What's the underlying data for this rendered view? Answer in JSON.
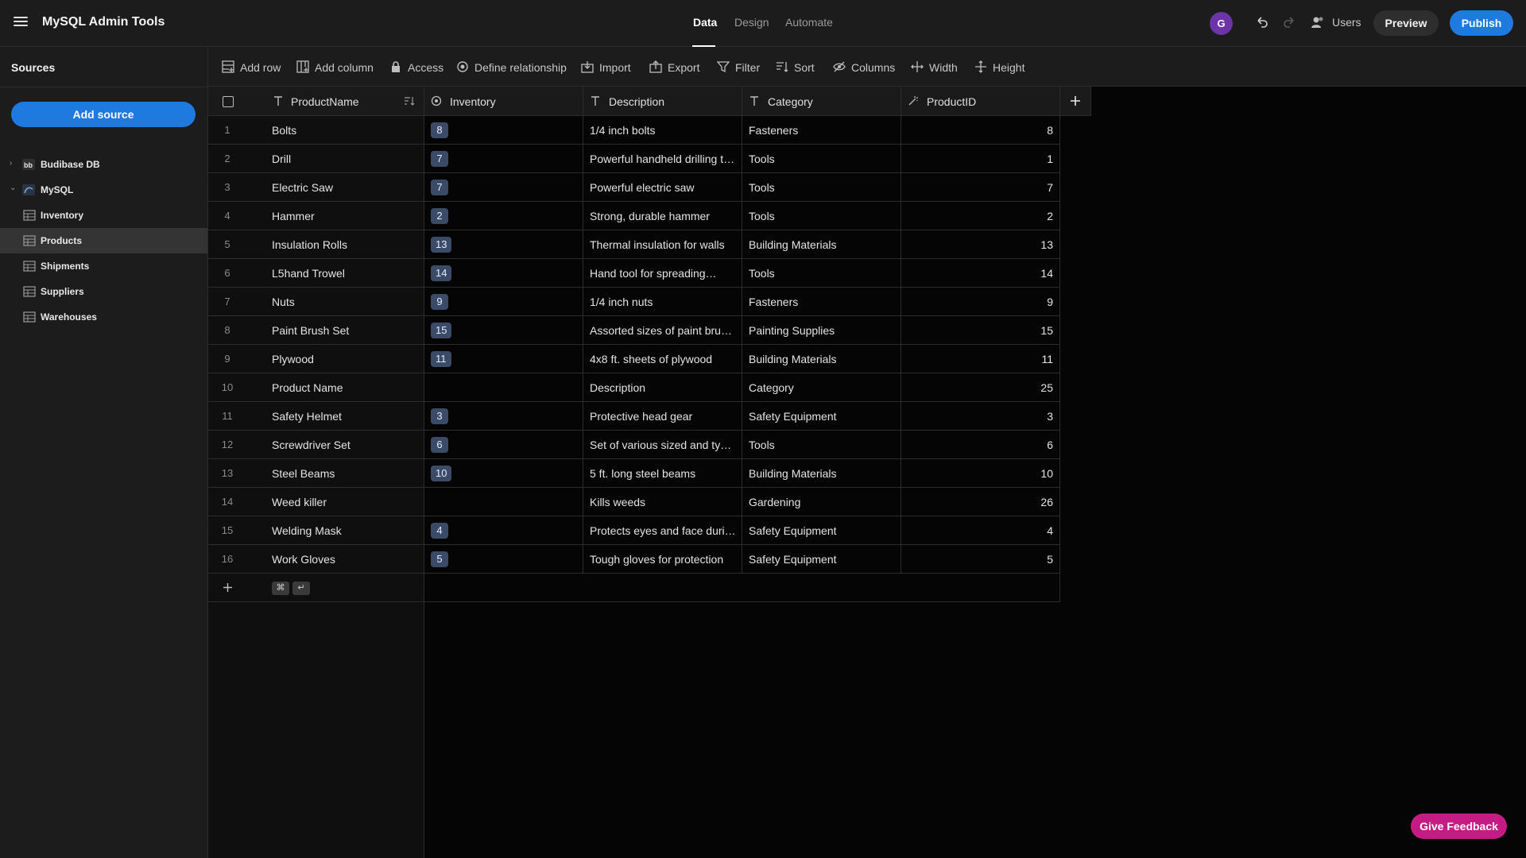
{
  "app": {
    "title": "MySQL Admin Tools"
  },
  "nav": {
    "tabs": [
      {
        "label": "Data"
      },
      {
        "label": "Design"
      },
      {
        "label": "Automate"
      }
    ]
  },
  "header": {
    "avatar_initial": "G",
    "users_label": "Users",
    "preview_label": "Preview",
    "publish_label": "Publish"
  },
  "sidebar": {
    "title": "Sources",
    "add_source_label": "Add source",
    "items": [
      {
        "label": "Budibase DB"
      },
      {
        "label": "MySQL"
      },
      {
        "label": "Inventory"
      },
      {
        "label": "Products"
      },
      {
        "label": "Shipments"
      },
      {
        "label": "Suppliers"
      },
      {
        "label": "Warehouses"
      }
    ]
  },
  "toolbar": {
    "items": [
      {
        "label": "Add row",
        "icon": "add-row-icon"
      },
      {
        "label": "Add column",
        "icon": "add-column-icon"
      },
      {
        "label": "Access",
        "icon": "lock-icon"
      },
      {
        "label": "Define relationship",
        "icon": "relationship-icon"
      },
      {
        "label": "Import",
        "icon": "import-icon"
      },
      {
        "label": "Export",
        "icon": "export-icon"
      },
      {
        "label": "Filter",
        "icon": "filter-icon"
      },
      {
        "label": "Sort",
        "icon": "sort-icon"
      },
      {
        "label": "Columns",
        "icon": "columns-icon"
      },
      {
        "label": "Width",
        "icon": "width-icon"
      },
      {
        "label": "Height",
        "icon": "height-icon"
      }
    ]
  },
  "grid": {
    "columns": [
      {
        "label": "ProductName",
        "icon": "text-type-icon"
      },
      {
        "label": "Inventory",
        "icon": "link-type-icon"
      },
      {
        "label": "Description",
        "icon": "text-type-icon"
      },
      {
        "label": "Category",
        "icon": "text-type-icon"
      },
      {
        "label": "ProductID",
        "icon": "auto-id-icon"
      }
    ],
    "rows": [
      {
        "idx": "1",
        "name": "Bolts",
        "inventory": "8",
        "description": "1/4 inch bolts",
        "category": "Fasteners",
        "id": "8"
      },
      {
        "idx": "2",
        "name": "Drill",
        "inventory": "7",
        "description": "Powerful handheld drilling tool",
        "category": "Tools",
        "id": "1"
      },
      {
        "idx": "3",
        "name": "Electric Saw",
        "inventory": "7",
        "description": "Powerful electric saw",
        "category": "Tools",
        "id": "7"
      },
      {
        "idx": "4",
        "name": "Hammer",
        "inventory": "2",
        "description": "Strong, durable hammer",
        "category": "Tools",
        "id": "2"
      },
      {
        "idx": "5",
        "name": "Insulation Rolls",
        "inventory": "13",
        "description": "Thermal insulation for walls",
        "category": "Building Materials",
        "id": "13"
      },
      {
        "idx": "6",
        "name": "L5hand Trowel",
        "inventory": "14",
        "description": "Hand tool for spreading…",
        "category": "Tools",
        "id": "14"
      },
      {
        "idx": "7",
        "name": "Nuts",
        "inventory": "9",
        "description": "1/4 inch nuts",
        "category": "Fasteners",
        "id": "9"
      },
      {
        "idx": "8",
        "name": "Paint Brush Set",
        "inventory": "15",
        "description": "Assorted sizes of paint brushes",
        "category": "Painting Supplies",
        "id": "15"
      },
      {
        "idx": "9",
        "name": "Plywood",
        "inventory": "11",
        "description": "4x8 ft. sheets of plywood",
        "category": "Building Materials",
        "id": "11"
      },
      {
        "idx": "10",
        "name": "Product Name",
        "inventory": "",
        "description": "Description",
        "category": "Category",
        "id": "25"
      },
      {
        "idx": "11",
        "name": "Safety Helmet",
        "inventory": "3",
        "description": "Protective head gear",
        "category": "Safety Equipment",
        "id": "3"
      },
      {
        "idx": "12",
        "name": "Screwdriver Set",
        "inventory": "6",
        "description": "Set of various sized and type…",
        "category": "Tools",
        "id": "6"
      },
      {
        "idx": "13",
        "name": "Steel Beams",
        "inventory": "10",
        "description": "5 ft. long steel beams",
        "category": "Building Materials",
        "id": "10"
      },
      {
        "idx": "14",
        "name": "Weed killer",
        "inventory": "",
        "description": "Kills weeds",
        "category": "Gardening",
        "id": "26"
      },
      {
        "idx": "15",
        "name": "Welding Mask",
        "inventory": "4",
        "description": "Protects eyes and face durin…",
        "category": "Safety Equipment",
        "id": "4"
      },
      {
        "idx": "16",
        "name": "Work Gloves",
        "inventory": "5",
        "description": "Tough gloves for protection",
        "category": "Safety Equipment",
        "id": "5"
      }
    ],
    "add_row_shortcut": {
      "key1": "⌘",
      "key2": "↵"
    }
  },
  "feedback_label": "Give Feedback",
  "colors": {
    "accent_blue": "#1f7ae0",
    "feedback_pink": "#c41c84",
    "avatar_purple": "#6b35a8",
    "pill_bg": "#3b4a66"
  }
}
